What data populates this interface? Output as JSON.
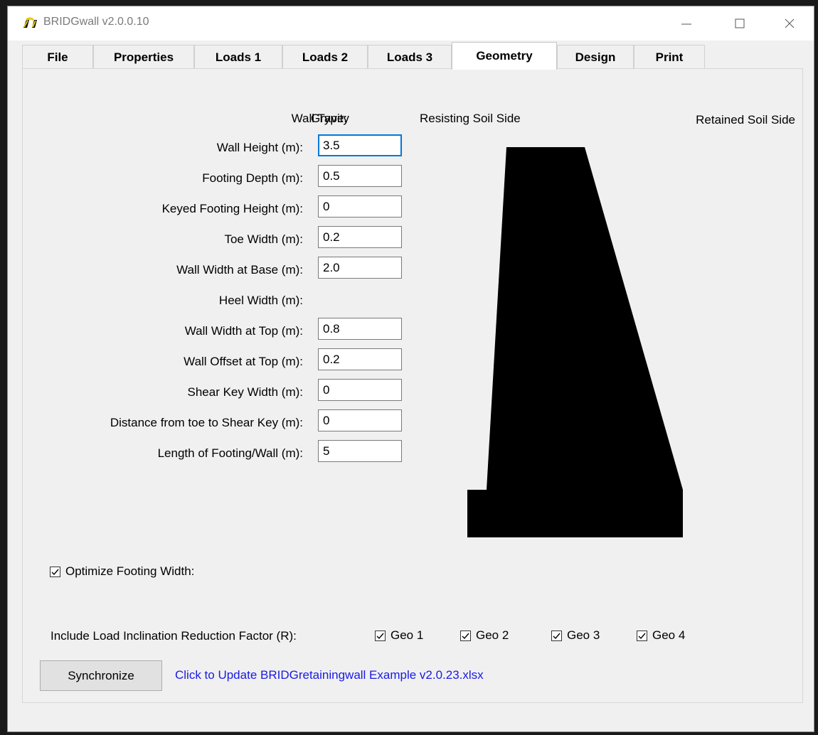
{
  "window": {
    "title": "BRIDGwall v2.0.0.10"
  },
  "tabs": [
    {
      "label": "File"
    },
    {
      "label": "Properties"
    },
    {
      "label": "Loads 1"
    },
    {
      "label": "Loads 2"
    },
    {
      "label": "Loads 3"
    },
    {
      "label": "Geometry"
    },
    {
      "label": "Design"
    },
    {
      "label": "Print"
    }
  ],
  "geometry": {
    "wall_type_label": "Wall Type:",
    "wall_type_value": "Gravity",
    "resisting_side_label": "Resisting Soil Side",
    "retained_side_label": "Retained Soil Side",
    "fields": [
      {
        "label": "Wall Height (m):",
        "value": "3.5"
      },
      {
        "label": "Footing Depth (m):",
        "value": "0.5"
      },
      {
        "label": "Keyed Footing Height (m):",
        "value": "0"
      },
      {
        "label": "Toe Width (m):",
        "value": "0.2"
      },
      {
        "label": "Wall Width at Base (m):",
        "value": "2.0"
      },
      {
        "label": "Heel Width (m):",
        "value": ""
      },
      {
        "label": "Wall Width at Top (m):",
        "value": "0.8"
      },
      {
        "label": "Wall Offset at Top (m):",
        "value": "0.2"
      },
      {
        "label": "Shear Key Width (m):",
        "value": "0"
      },
      {
        "label": "Distance from toe to Shear Key (m):",
        "value": "0"
      },
      {
        "label": "Length of Footing/Wall (m):",
        "value": "5"
      }
    ],
    "optimize_label": "Optimize Footing Width:",
    "optimize_checked": true,
    "reduction_label": "Include Load Inclination Reduction Factor (R):",
    "geo_checks": [
      {
        "label": "Geo 1",
        "checked": true
      },
      {
        "label": "Geo 2",
        "checked": true
      },
      {
        "label": "Geo 3",
        "checked": true
      },
      {
        "label": "Geo 4",
        "checked": true
      }
    ],
    "sync_button": "Synchronize",
    "update_link": "Click to Update BRIDGretainingwall Example v2.0.23.xlsx"
  },
  "colors": {
    "wall_fill": "#000000",
    "link": "#1a1ae6",
    "focus": "#0078d7"
  }
}
